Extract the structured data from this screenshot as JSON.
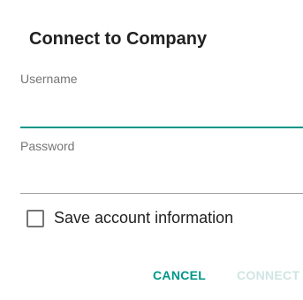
{
  "dialog": {
    "title": "Connect to Company",
    "username": {
      "label": "Username",
      "value": ""
    },
    "password": {
      "label": "Password",
      "value": ""
    },
    "save_account": {
      "label": "Save account information",
      "checked": false
    },
    "buttons": {
      "cancel": "CANCEL",
      "connect": "CONNECT"
    }
  },
  "colors": {
    "accent": "#009688",
    "disabled_button": "#cfe5e2",
    "text_primary": "#212121",
    "text_secondary": "#757575"
  }
}
